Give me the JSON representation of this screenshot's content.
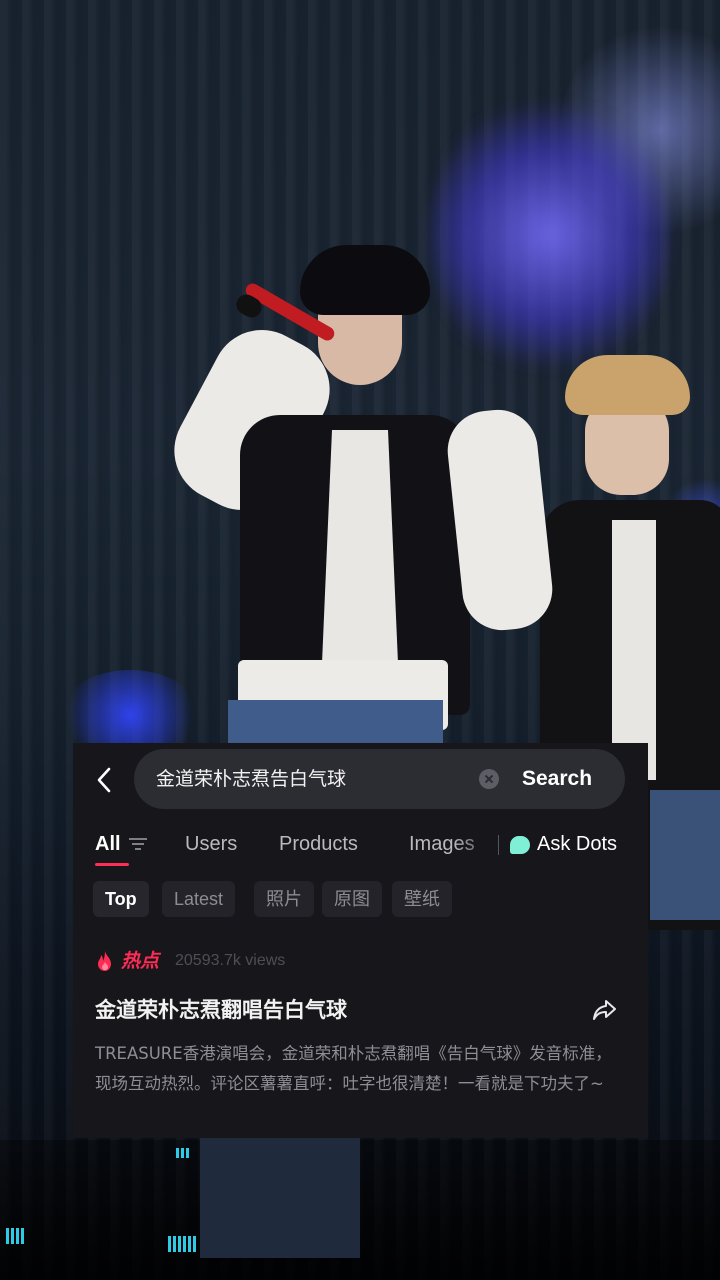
{
  "search": {
    "query": "金道荣朴志焄告白气球",
    "button_label": "Search"
  },
  "tabs": [
    {
      "label": "All",
      "active": true
    },
    {
      "label": "Users"
    },
    {
      "label": "Products"
    },
    {
      "label": "Images"
    },
    {
      "label": "Ask Dots"
    }
  ],
  "chips": [
    {
      "label": "Top",
      "active": true
    },
    {
      "label": "Latest"
    },
    {
      "label": "照片"
    },
    {
      "label": "原图"
    },
    {
      "label": "壁纸"
    }
  ],
  "result": {
    "badge": "热点",
    "views": "20593.7k views",
    "title": "金道荣朴志焄翻唱告白气球",
    "description": "TREASURE香港演唱会，金道荣和朴志焄翻唱《告白气球》发音标准，现场互动热烈。评论区薯薯直呼：吐字也很清楚！一看就是下功夫了~"
  },
  "colors": {
    "accent": "#fe2c55",
    "panel_bg": "#16161b",
    "ask_dots_icon": "#7ff0d6"
  },
  "icons": [
    "back-arrow-icon",
    "clear-icon",
    "filter-icon",
    "ask-dots-icon",
    "fire-icon",
    "share-icon"
  ]
}
